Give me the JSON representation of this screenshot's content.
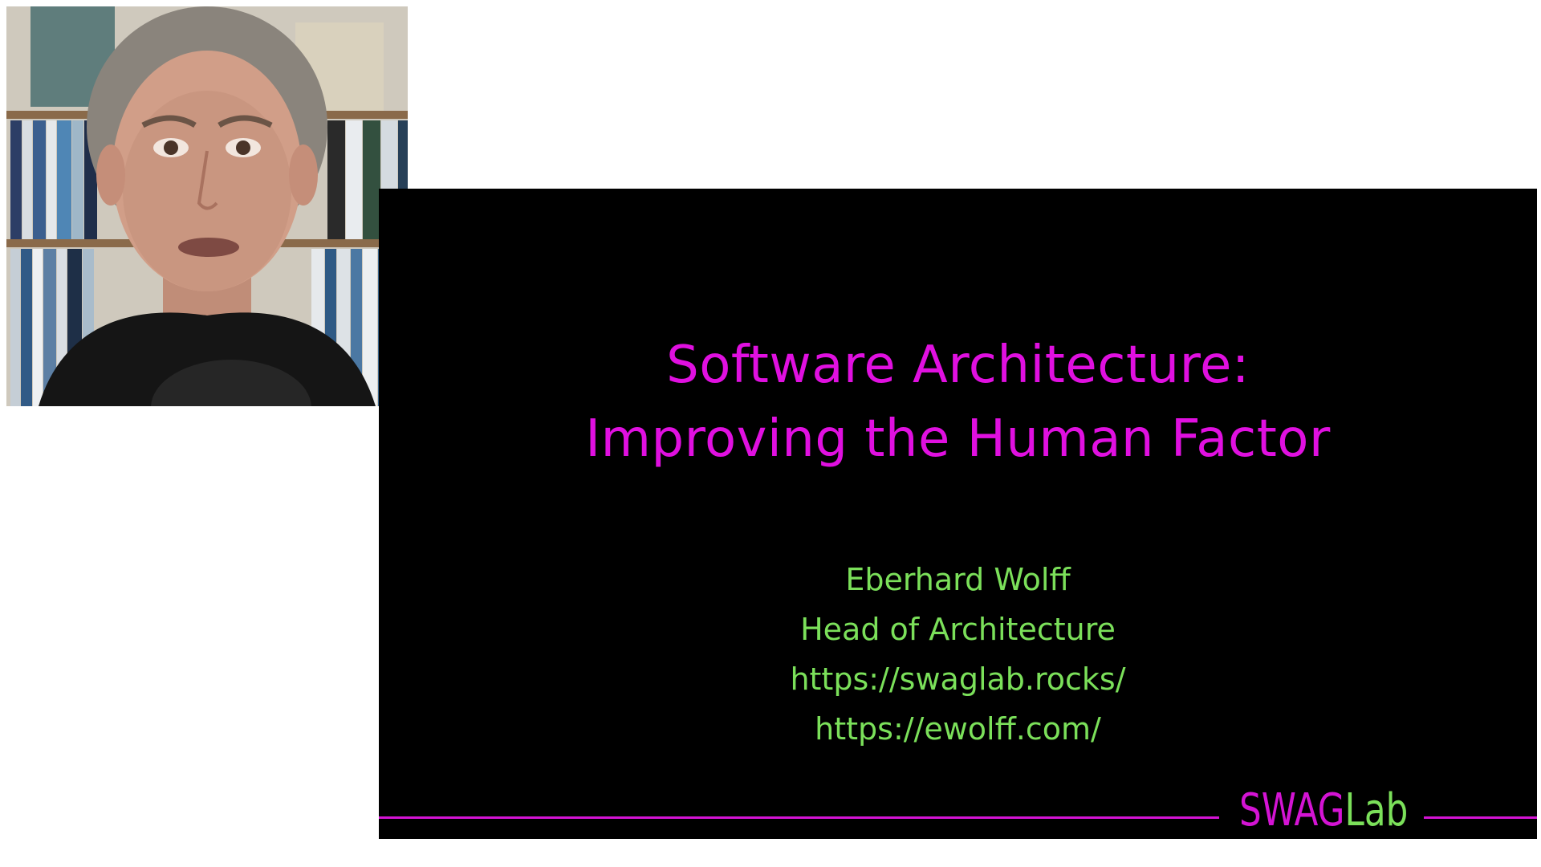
{
  "slide": {
    "title_line_1": "Software Architecture:",
    "title_line_2": "Improving the Human Factor",
    "author_lines": [
      "Eberhard Wolff",
      "Head of Architecture",
      "https://swaglab.rocks/",
      "https://ewolff.com/"
    ],
    "brand": {
      "part1": "SWAG",
      "part2": "Lab"
    }
  },
  "webcam": {
    "subject": "presenter-video"
  },
  "colors": {
    "background": "#ffffff",
    "slide_background": "#000000",
    "title": "#e010e0",
    "author_text": "#7be05a",
    "accent_line": "#d414d4"
  }
}
